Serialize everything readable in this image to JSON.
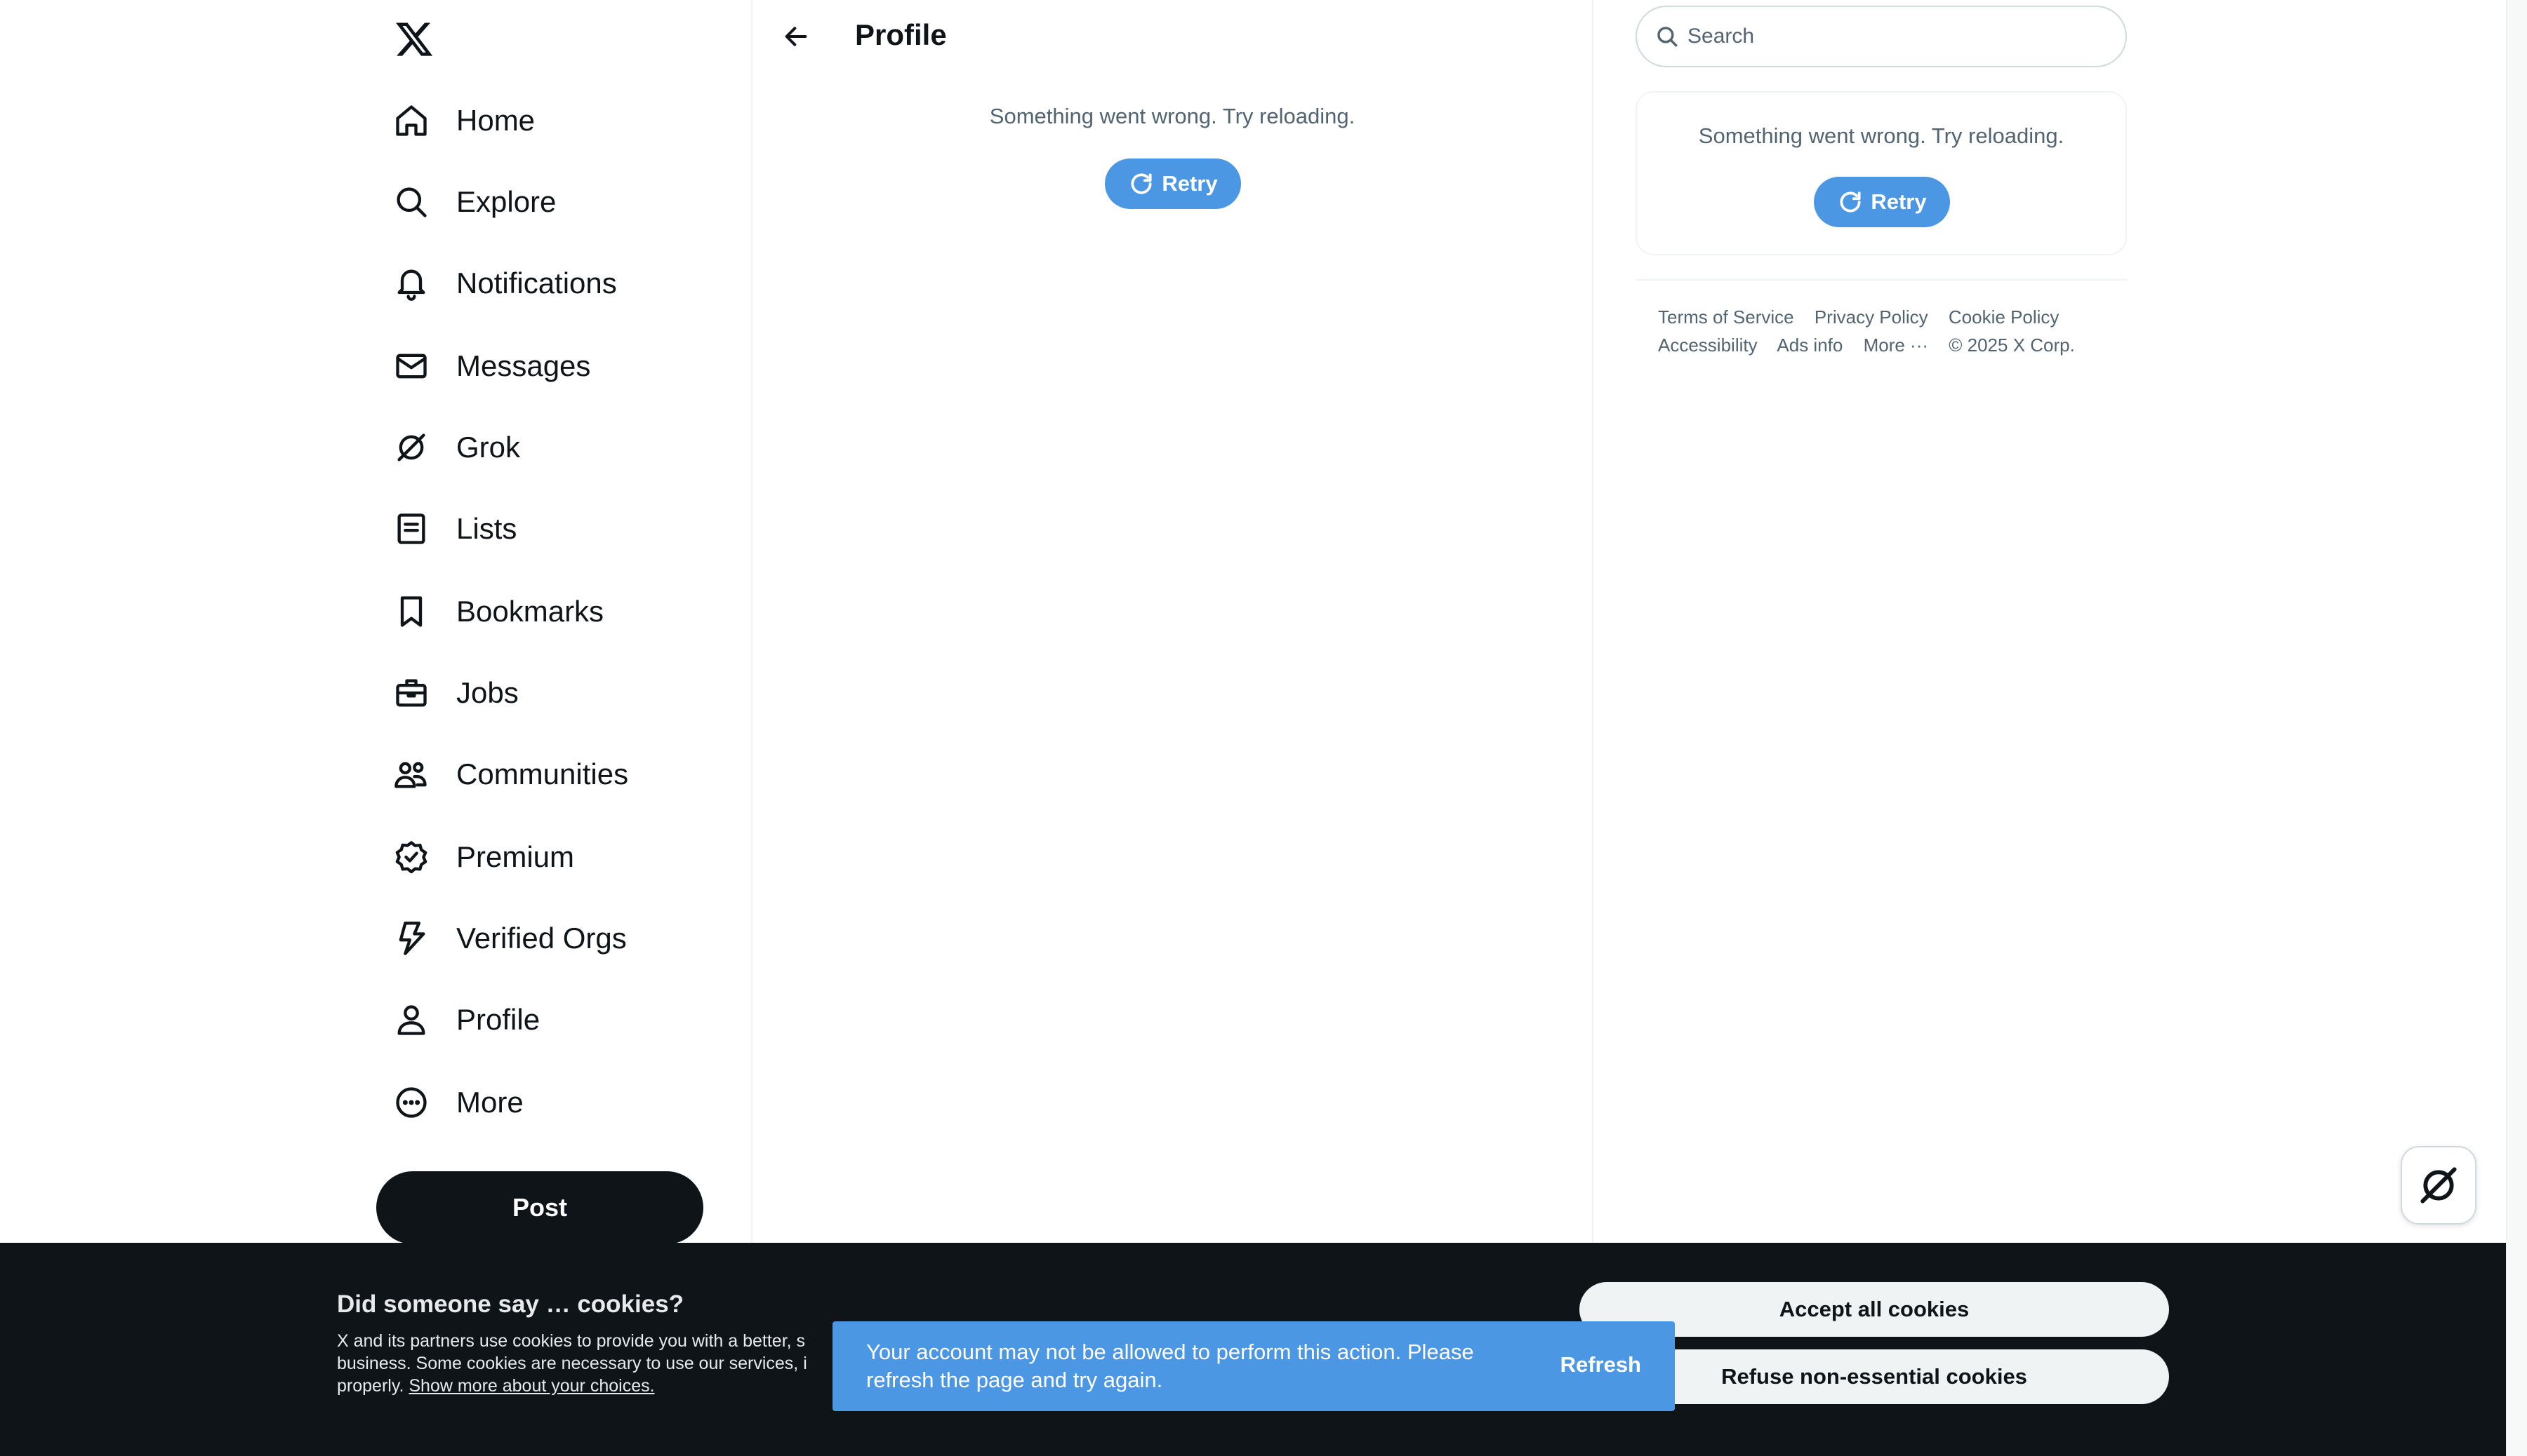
{
  "nav": {
    "logo_icon": "x-logo-icon",
    "items": [
      {
        "label": "Home",
        "icon": "home-icon"
      },
      {
        "label": "Explore",
        "icon": "search-icon"
      },
      {
        "label": "Notifications",
        "icon": "bell-icon"
      },
      {
        "label": "Messages",
        "icon": "envelope-icon"
      },
      {
        "label": "Grok",
        "icon": "grok-icon"
      },
      {
        "label": "Lists",
        "icon": "list-icon"
      },
      {
        "label": "Bookmarks",
        "icon": "bookmark-icon"
      },
      {
        "label": "Jobs",
        "icon": "briefcase-icon"
      },
      {
        "label": "Communities",
        "icon": "people-icon"
      },
      {
        "label": "Premium",
        "icon": "verified-badge-icon"
      },
      {
        "label": "Verified Orgs",
        "icon": "lightning-icon"
      },
      {
        "label": "Profile",
        "icon": "person-icon"
      },
      {
        "label": "More",
        "icon": "more-circle-icon"
      }
    ],
    "post_label": "Post"
  },
  "main": {
    "title": "Profile",
    "error_text": "Something went wrong. Try reloading.",
    "retry_label": "Retry"
  },
  "sidebar": {
    "search_placeholder": "Search",
    "error_text": "Something went wrong. Try reloading.",
    "retry_label": "Retry",
    "footer": {
      "terms": "Terms of Service",
      "privacy": "Privacy Policy",
      "cookie": "Cookie Policy",
      "accessibility": "Accessibility",
      "ads": "Ads info",
      "more": "More ···",
      "copyright": "© 2025 X Corp."
    }
  },
  "cookie_banner": {
    "title": "Did someone say … cookies?",
    "line1": "X and its partners use cookies to provide you with a better, s",
    "line2": "business. Some cookies are necessary to use our services, i",
    "line3_prefix": "properly. ",
    "link": "Show more about your choices.",
    "accept_label": "Accept all cookies",
    "refuse_label": "Refuse non-essential cookies"
  },
  "toast": {
    "message": "Your account may not be allowed to perform this action. Please refresh the page and try again.",
    "action": "Refresh"
  },
  "colors": {
    "accent": "#4c97e3",
    "text": "#0f1419",
    "muted": "#536471",
    "banner_bg": "#0f1419"
  }
}
